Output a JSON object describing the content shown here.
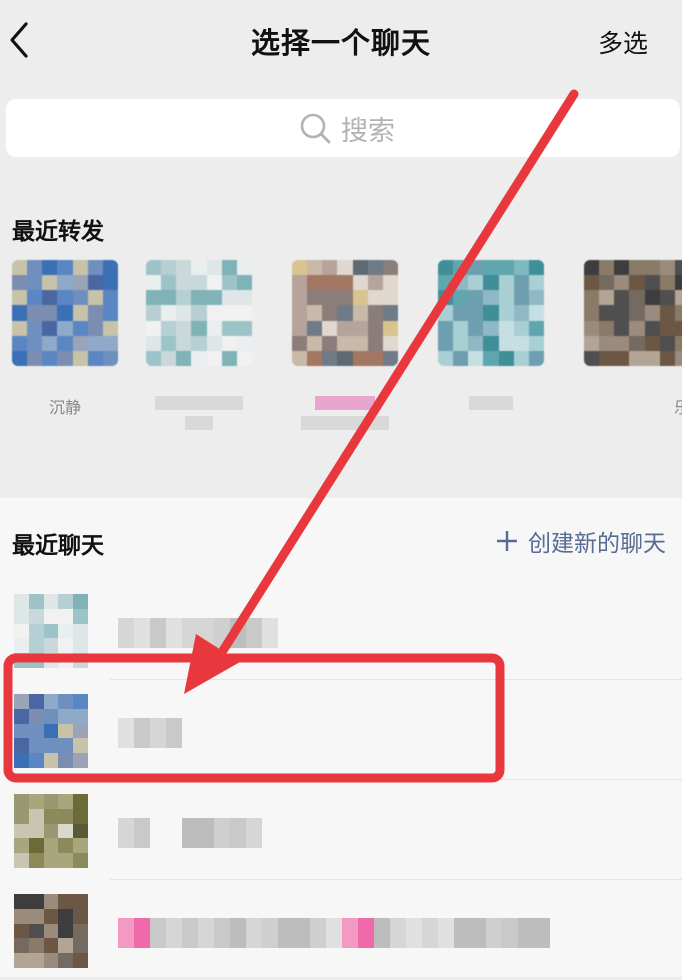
{
  "nav": {
    "title": "选择一个聊天",
    "multi_select": "多选"
  },
  "search": {
    "placeholder": "搜索"
  },
  "recent_forward": {
    "title": "最近转发",
    "items": [
      {
        "name": "沉静"
      },
      {
        "name": ""
      },
      {
        "name": ""
      },
      {
        "name": ""
      },
      {
        "name": "乐"
      }
    ]
  },
  "recent_chats": {
    "title": "最近聊天",
    "new_chat": "创建新的聊天"
  },
  "colors": {
    "link": "#576b95",
    "annotation": "#e8383d",
    "background": "#ededed"
  },
  "icons": [
    "back-chevron-icon",
    "search-icon",
    "plus-icon"
  ]
}
